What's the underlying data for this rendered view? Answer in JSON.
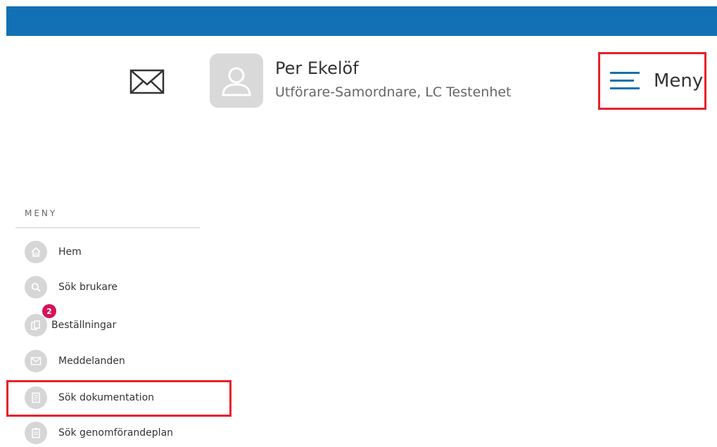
{
  "header": {
    "user_name": "Per Ekelöf",
    "user_role": "Utförare-Samordnare, LC Testenhet",
    "menu_label": "Meny"
  },
  "sidebar": {
    "title": "MENY",
    "items": [
      {
        "label": "Hem",
        "icon": "home-icon"
      },
      {
        "label": "Sök brukare",
        "icon": "search-icon"
      },
      {
        "label": "Beställningar",
        "icon": "documents-icon",
        "badge": "2"
      },
      {
        "label": "Meddelanden",
        "icon": "mail-icon"
      },
      {
        "label": "Sök dokumentation",
        "icon": "document-search-icon"
      },
      {
        "label": "Sök genomförandeplan",
        "icon": "clipboard-icon"
      }
    ]
  },
  "colors": {
    "brand": "#1271b4",
    "highlight": "#e8202a",
    "badge": "#d4145a"
  }
}
